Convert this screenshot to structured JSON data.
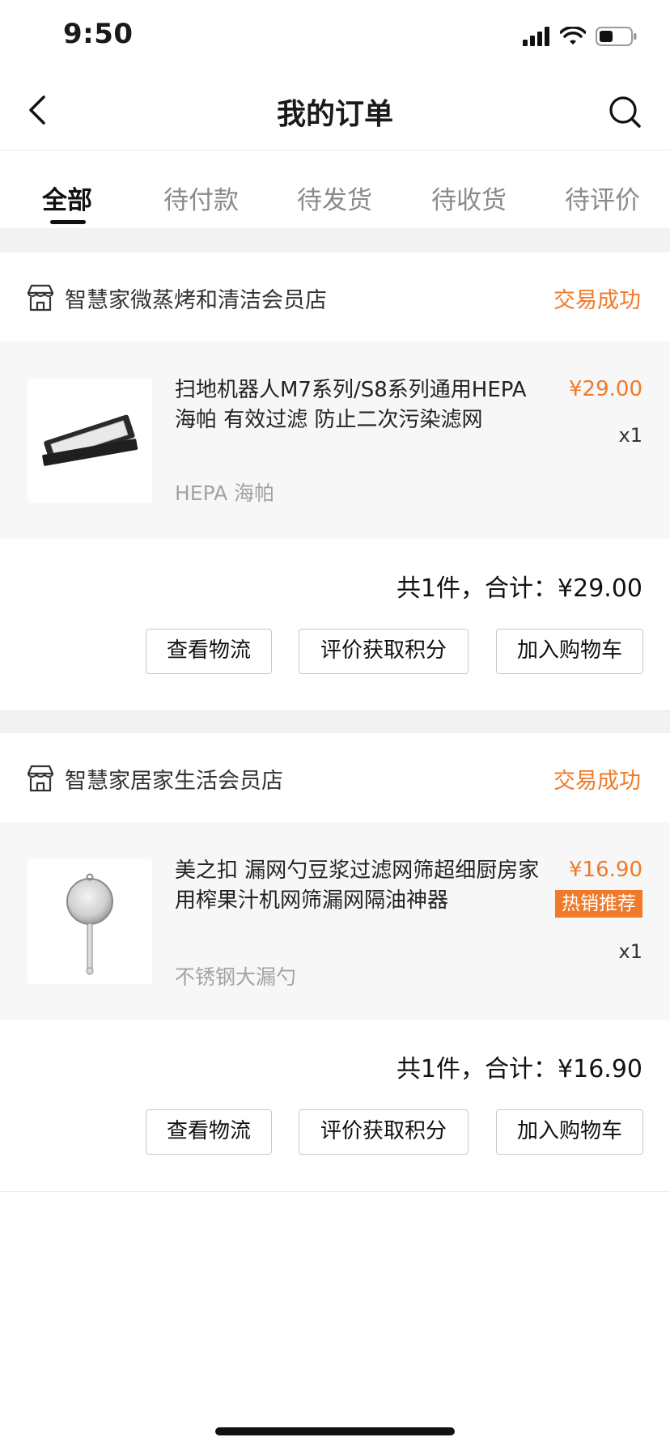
{
  "status_bar": {
    "time": "9:50"
  },
  "nav": {
    "title": "我的订单"
  },
  "tabs": [
    {
      "label": "全部",
      "active": true
    },
    {
      "label": "待付款",
      "active": false
    },
    {
      "label": "待发货",
      "active": false
    },
    {
      "label": "待收货",
      "active": false
    },
    {
      "label": "待评价",
      "active": false
    }
  ],
  "orders": [
    {
      "store_name": "智慧家微蒸烤和清洁会员店",
      "status": "交易成功",
      "item": {
        "title": "扫地机器人M7系列/S8系列通用HEPA 海帕 有效过滤 防止二次污染滤网",
        "spec": "HEPA 海帕",
        "price": "¥29.00",
        "qty": "x1"
      },
      "total": "共1件，合计：¥29.00",
      "buttons": [
        "查看物流",
        "评价获取积分",
        "加入购物车"
      ]
    },
    {
      "store_name": "智慧家居家生活会员店",
      "status": "交易成功",
      "item": {
        "title": "美之扣 漏网勺豆浆过滤网筛超细厨房家用榨果汁机网筛漏网隔油神器",
        "spec": "不锈钢大漏勺",
        "price": "¥16.90",
        "badge": "热销推荐",
        "qty": "x1"
      },
      "total": "共1件，合计：¥16.90",
      "buttons": [
        "查看物流",
        "评价获取积分",
        "加入购物车"
      ]
    }
  ],
  "colors": {
    "accent": "#f07a2a",
    "band": "#f2f2f2",
    "item_bg": "#f7f7f7"
  },
  "icons": [
    "back-icon",
    "search-icon",
    "store-icon",
    "signal-icon",
    "wifi-icon",
    "battery-icon"
  ]
}
